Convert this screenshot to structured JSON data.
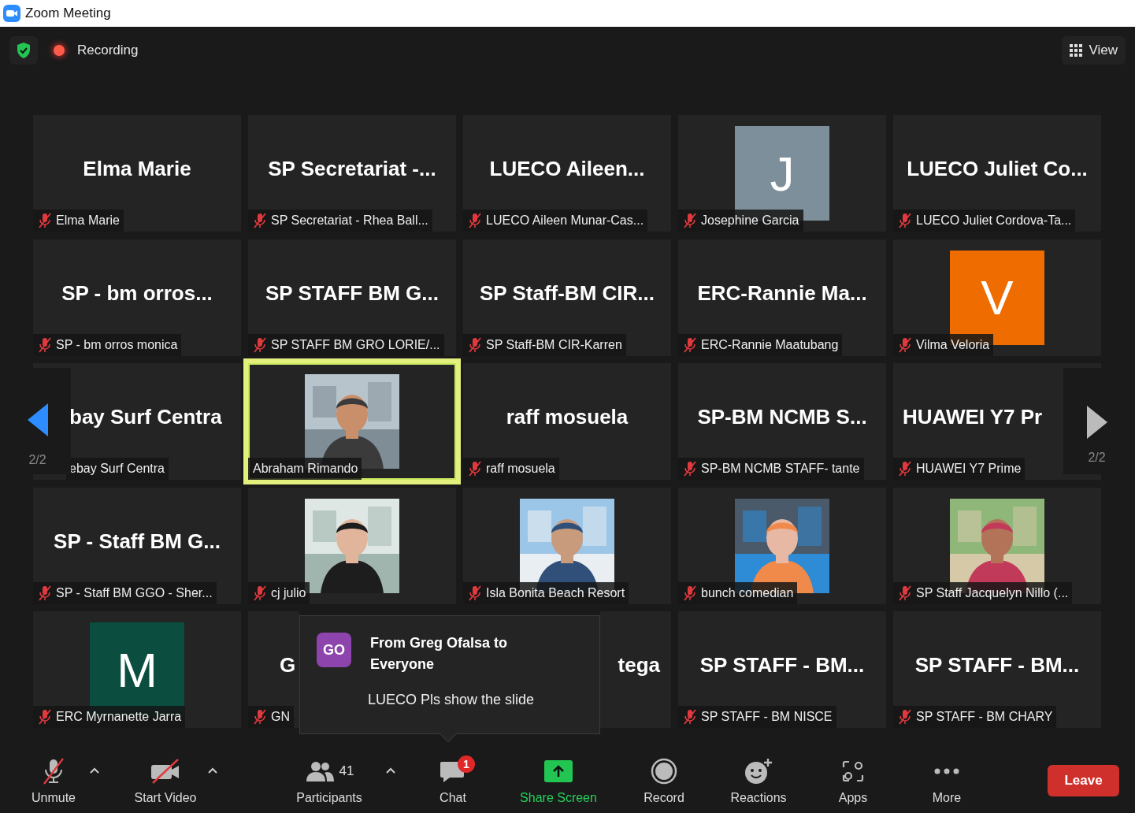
{
  "window": {
    "title": "Zoom Meeting"
  },
  "top_bar": {
    "recording": "Recording",
    "view_button": "View"
  },
  "pager": {
    "left": "2/2",
    "right": "2/2"
  },
  "tiles": [
    {
      "kind": "name",
      "name": "Elma Marie",
      "label": "Elma Marie",
      "muted": true,
      "selected": false
    },
    {
      "kind": "name",
      "name": "SP Secretariat -...",
      "label": "SP Secretariat - Rhea Ball...",
      "muted": true,
      "selected": false
    },
    {
      "kind": "name",
      "name": "LUECO Aileen...",
      "label": "LUECO Aileen Munar-Cas...",
      "muted": true,
      "selected": false
    },
    {
      "kind": "avatar",
      "letter": "J",
      "color": "#7d8f9a",
      "label": "Josephine Garcia",
      "muted": true,
      "selected": false
    },
    {
      "kind": "name",
      "name": "LUECO Juliet Co...",
      "label": "LUECO Juliet Cordova-Ta...",
      "muted": true,
      "selected": false
    },
    {
      "kind": "name",
      "name": "SP - bm orros...",
      "label": "SP - bm orros monica",
      "muted": true,
      "selected": false
    },
    {
      "kind": "name",
      "name": "SP STAFF BM G...",
      "label": "SP STAFF BM GRO LORIE/...",
      "muted": true,
      "selected": false
    },
    {
      "kind": "name",
      "name": "SP Staff-BM CIR...",
      "label": "SP Staff-BM CIR-Karren",
      "muted": true,
      "selected": false
    },
    {
      "kind": "name",
      "name": "ERC-Rannie Ma...",
      "label": "ERC-Rannie Maatubang",
      "muted": true,
      "selected": false
    },
    {
      "kind": "avatar",
      "letter": "V",
      "color": "#ef6c00",
      "label": "Vilma Veloria",
      "muted": true,
      "selected": false
    },
    {
      "kind": "name_left",
      "name": "bay Surf Centra",
      "label": "ebay Surf Centra",
      "muted": false,
      "selected": false
    },
    {
      "label": "Abraham Rimando",
      "muted": false,
      "selected": true
    },
    {
      "kind": "name",
      "name": "raff mosuela",
      "label": "raff mosuela",
      "muted": true,
      "selected": false
    },
    {
      "kind": "name",
      "name": "SP-BM NCMB S...",
      "label": "SP-BM NCMB STAFF- tante",
      "muted": true,
      "selected": false
    },
    {
      "kind": "name_left",
      "name": "HUAWEI Y7 Pr",
      "label": "HUAWEI Y7 Prime",
      "muted": true,
      "selected": false
    },
    {
      "kind": "name",
      "name": "SP - Staff BM G...",
      "label": "SP - Staff BM GGO - Sher...",
      "muted": true,
      "selected": false
    },
    {
      "label": "cj julio",
      "muted": true,
      "selected": false
    },
    {
      "label": "Isla Bonita Beach Resort",
      "muted": true,
      "selected": false
    },
    {
      "label": "bunch comedian",
      "muted": true,
      "selected": false
    },
    {
      "label": "SP Staff Jacquelyn Nillo (...",
      "muted": true,
      "selected": false
    },
    {
      "kind": "avatar",
      "letter": "M",
      "color": "#0b4d3f",
      "label": "ERC Myrnanette Jarra",
      "muted": true,
      "selected": false
    },
    {
      "kind": "name_left",
      "name": "G",
      "label": "GN",
      "muted": true,
      "selected": false
    },
    {
      "kind": "name_right",
      "name": "tega",
      "selected": false
    },
    {
      "kind": "name",
      "name": "SP STAFF - BM...",
      "label": "SP STAFF - BM NISCE",
      "muted": true,
      "selected": false
    },
    {
      "kind": "name",
      "name": "SP STAFF - BM...",
      "label": "SP STAFF - BM CHARY",
      "muted": true,
      "selected": false
    }
  ],
  "chat_popup": {
    "initials": "GO",
    "from": "From Greg Ofalsa to Everyone",
    "message": "LUECO Pls show the slide"
  },
  "toolbar": [
    {
      "kind": "mic",
      "label": "Unmute",
      "caret": true
    },
    {
      "kind": "video",
      "label": "Start Video",
      "caret": true
    },
    {
      "kind": "participants",
      "label": "Participants",
      "count": "41",
      "caret": true
    },
    {
      "kind": "chat",
      "label": "Chat",
      "badge": "1"
    },
    {
      "kind": "share",
      "label": "Share Screen"
    },
    {
      "kind": "record",
      "label": "Record"
    },
    {
      "kind": "reactions",
      "label": "Reactions"
    },
    {
      "kind": "apps",
      "label": "Apps"
    },
    {
      "kind": "more",
      "label": "More"
    }
  ],
  "leave_button": "Leave"
}
